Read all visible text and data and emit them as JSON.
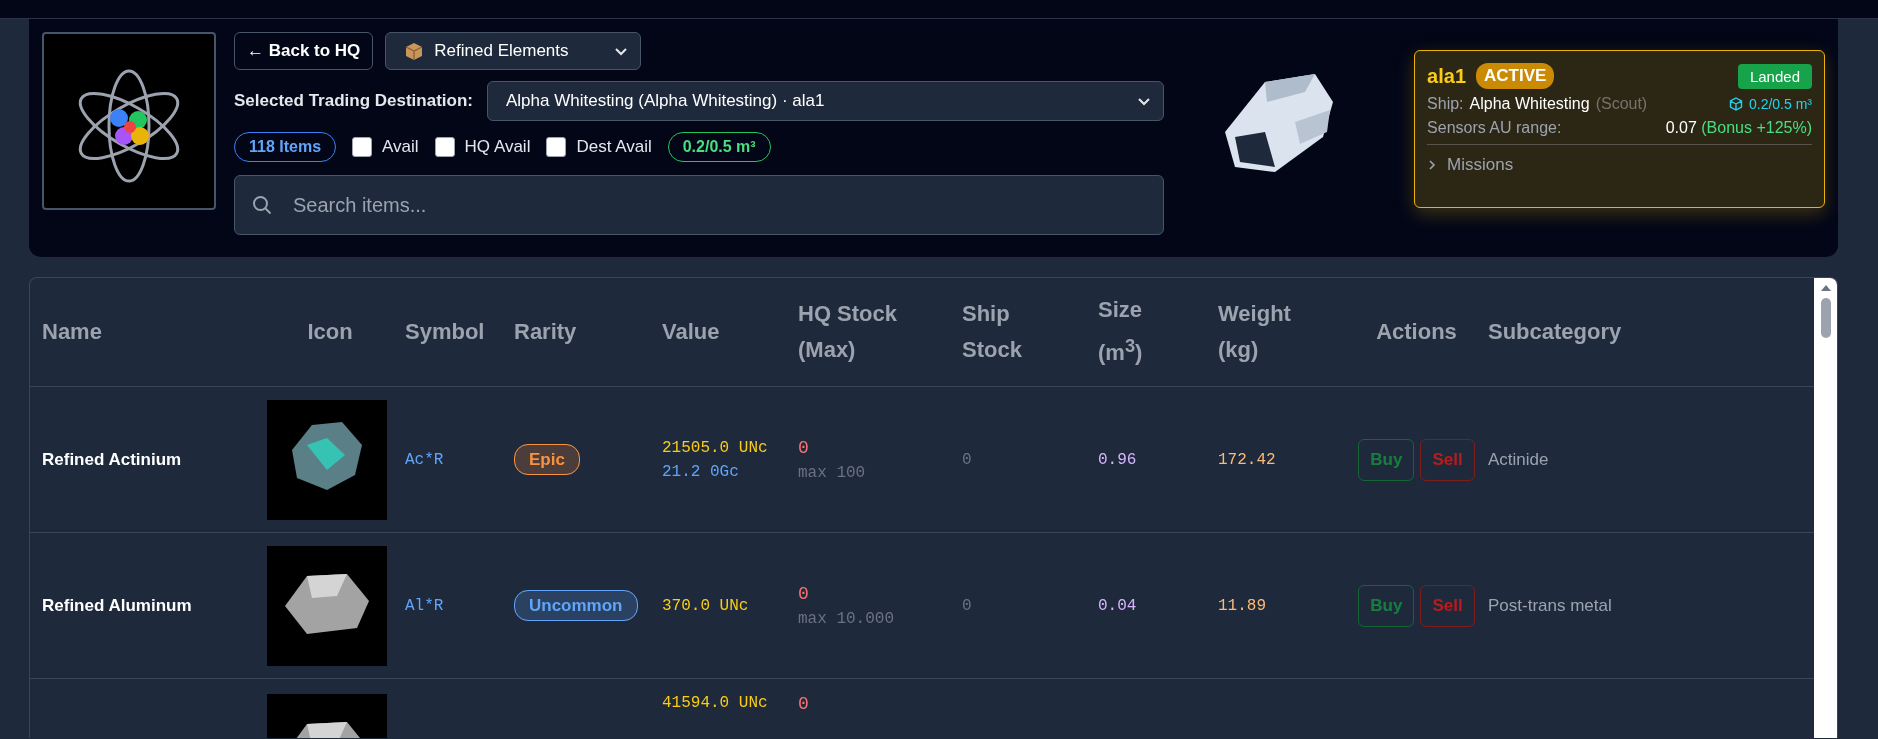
{
  "header": {
    "back_button": "← Back to HQ",
    "category_select": {
      "value": "Refined Elements"
    },
    "destination": {
      "label": "Selected Trading Destination:",
      "value": "Alpha Whitesting (Alpha Whitesting) · ala1"
    },
    "item_count": "118 Items",
    "filters": [
      {
        "label": "Avail",
        "checked": false
      },
      {
        "label": "HQ Avail",
        "checked": false
      },
      {
        "label": "Dest Avail",
        "checked": false
      }
    ],
    "capacity": "0.2/0.5 m³",
    "search": {
      "placeholder": "Search items..."
    }
  },
  "ship_card": {
    "name": "ala1",
    "status_badge": "ACTIVE",
    "location_badge": "Landed",
    "ship_label": "Ship:",
    "ship_name": "Alpha Whitesting",
    "ship_class": "(Scout)",
    "cargo": "0.2/0.5 m³",
    "sensors_label": "Sensors AU range:",
    "sensors_value": "0.07",
    "sensors_bonus": "(Bonus +125%)",
    "missions": {
      "label": "Missions",
      "expanded": false
    }
  },
  "table": {
    "columns": [
      "Name",
      "Icon",
      "Symbol",
      "Rarity",
      "Value",
      "HQ Stock (Max)",
      "Ship Stock",
      "Size (m$^{3}$)",
      "Weight (kg)",
      "Actions",
      "Subcategory"
    ],
    "rows": [
      {
        "name": "Refined Actinium",
        "kind": "crystal",
        "symbol": "Ac*R",
        "rarity": {
          "label": "Epic",
          "color": "#fb923c"
        },
        "value_unc": "21505.0 UNc",
        "value_gc": "21.2 0Gc",
        "hq_stock": "0",
        "hq_max": "max 100",
        "ship_stock": "0",
        "size": "0.96",
        "weight": "172.42",
        "buy": "Buy",
        "sell": "Sell",
        "subcategory": "Actinide"
      },
      {
        "name": "Refined Aluminum",
        "kind": "rock",
        "symbol": "Al*R",
        "rarity": {
          "label": "Uncommon",
          "color": "#60a5fa"
        },
        "value_unc": "370.0 UNc",
        "hq_stock": "0",
        "hq_max": "max 10.000",
        "ship_stock": "0",
        "size": "0.04",
        "weight": "11.89",
        "buy": "Buy",
        "sell": "Sell",
        "subcategory": "Post-trans metal"
      },
      {
        "kind": "rock",
        "value_unc": "41594.0 UNc",
        "hq_stock": "0"
      }
    ]
  }
}
